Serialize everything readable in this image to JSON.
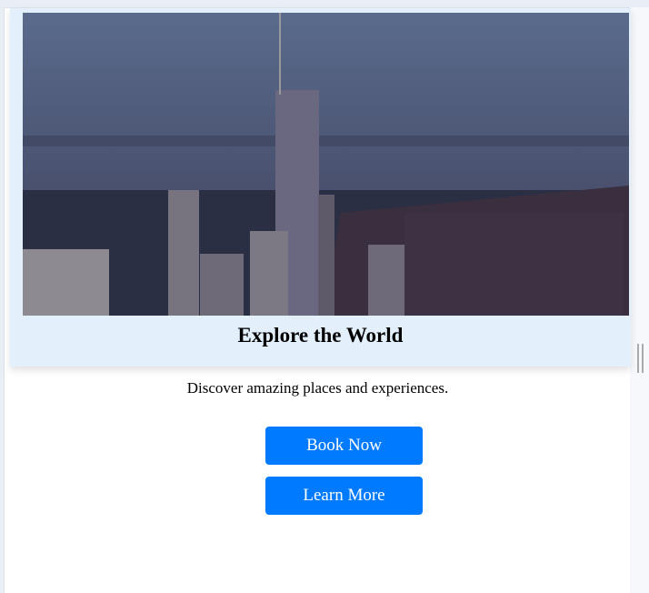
{
  "card": {
    "title": "Explore the World",
    "image_alt": "city skyline at dusk"
  },
  "description": "Discover amazing places and experiences.",
  "buttons": {
    "book": "Book Now",
    "learn": "Learn More"
  },
  "colors": {
    "accent": "#007bff",
    "card_bg": "#e3f0fc"
  }
}
